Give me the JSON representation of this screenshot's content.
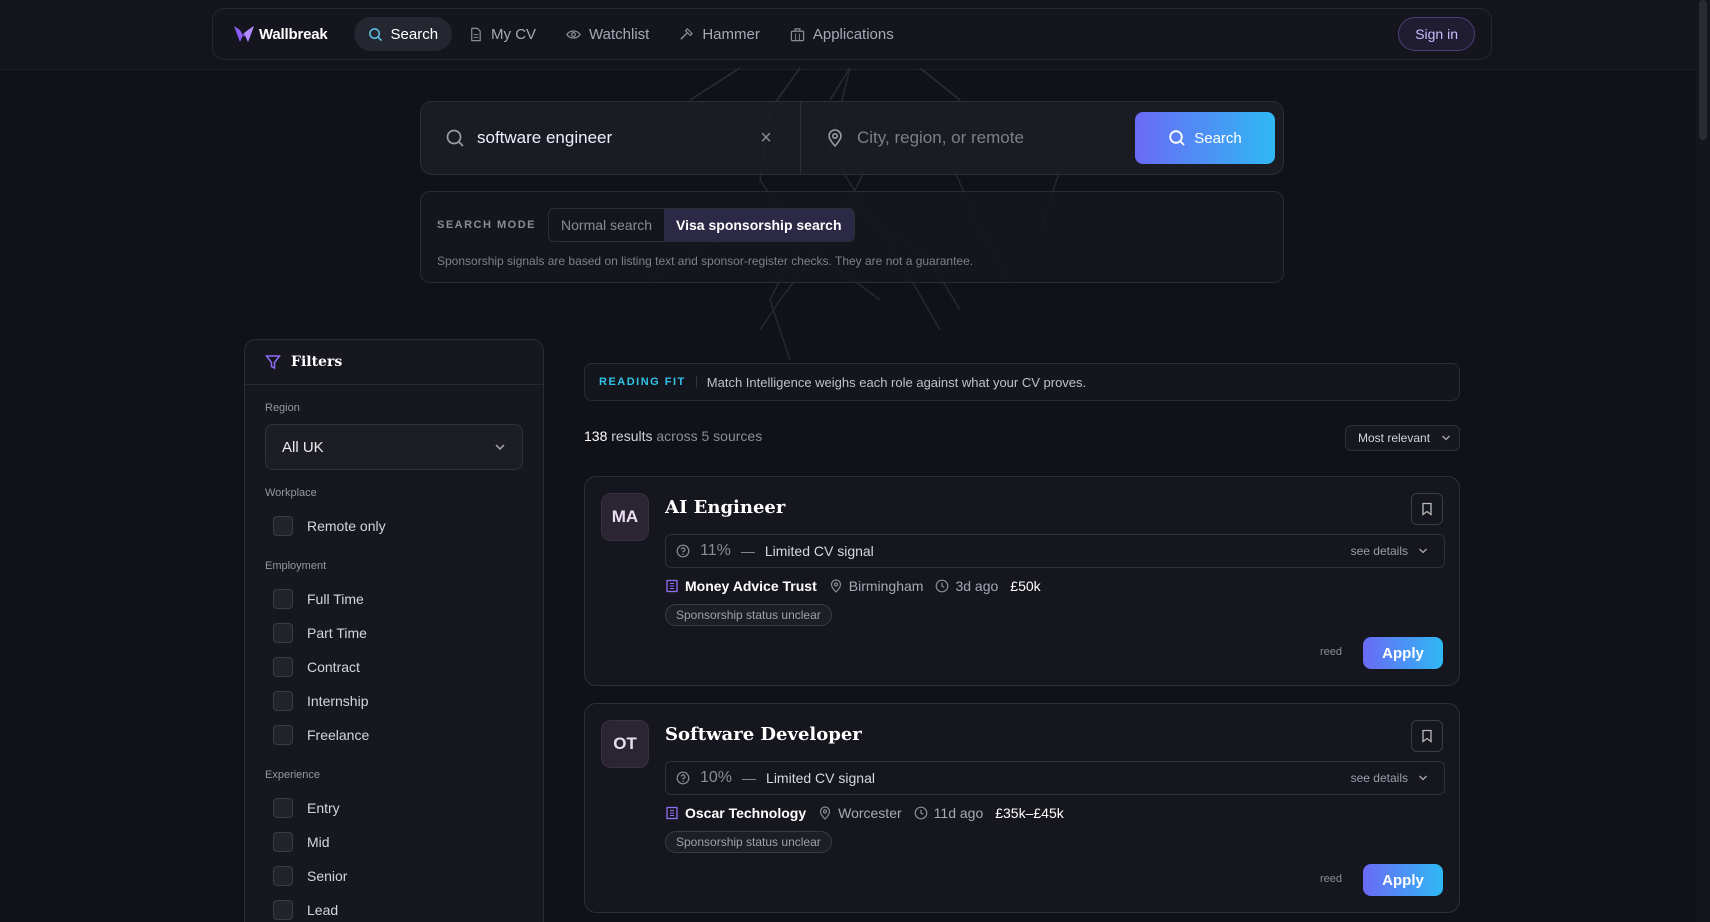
{
  "nav": {
    "brand": "Wallbreak",
    "items": [
      {
        "label": "Search",
        "icon": "search-icon",
        "active": true
      },
      {
        "label": "My CV",
        "icon": "document-icon"
      },
      {
        "label": "Watchlist",
        "icon": "eye-icon"
      },
      {
        "label": "Hammer",
        "icon": "hammer-icon"
      },
      {
        "label": "Applications",
        "icon": "briefcase-icon"
      }
    ],
    "signin": "Sign in"
  },
  "search": {
    "query": "software engineer",
    "location_placeholder": "City, region, or remote",
    "button": "Search"
  },
  "mode": {
    "label": "SEARCH MODE",
    "options": [
      "Normal search",
      "Visa sponsorship search"
    ],
    "selected": "Visa sponsorship search",
    "note": "Sponsorship signals are based on listing text and sponsor-register checks. They are not a guarantee."
  },
  "filters": {
    "title": "Filters",
    "region": {
      "label": "Region",
      "value": "All UK"
    },
    "workplace": {
      "label": "Workplace",
      "options": [
        "Remote only"
      ]
    },
    "employment": {
      "label": "Employment",
      "options": [
        "Full Time",
        "Part Time",
        "Contract",
        "Internship",
        "Freelance"
      ]
    },
    "experience": {
      "label": "Experience",
      "options": [
        "Entry",
        "Mid",
        "Senior",
        "Lead"
      ]
    }
  },
  "fit": {
    "tag": "READING FIT",
    "message": "Match Intelligence weighs each role against what your CV proves."
  },
  "results": {
    "count": "138",
    "count_word": "results",
    "sources": "across 5 sources",
    "sort": "Most relevant"
  },
  "jobs": [
    {
      "initials": "MA",
      "title": "AI Engineer",
      "pct": "11%",
      "signal": "Limited CV signal",
      "details": "see details",
      "company": "Money Advice Trust",
      "location": "Birmingham",
      "age": "3d ago",
      "salary": "£50k",
      "badge": "Sponsorship status unclear",
      "source": "reed",
      "apply": "Apply"
    },
    {
      "initials": "OT",
      "title": "Software Developer",
      "pct": "10%",
      "signal": "Limited CV signal",
      "details": "see details",
      "company": "Oscar Technology",
      "location": "Worcester",
      "age": "11d ago",
      "salary": "£35k–£45k",
      "badge": "Sponsorship status unclear",
      "source": "reed",
      "apply": "Apply"
    }
  ],
  "colors": {
    "accent_start": "#6a6af5",
    "accent_end": "#2fb8f5",
    "fit_tag": "#30c3e8",
    "background": "#111218"
  }
}
